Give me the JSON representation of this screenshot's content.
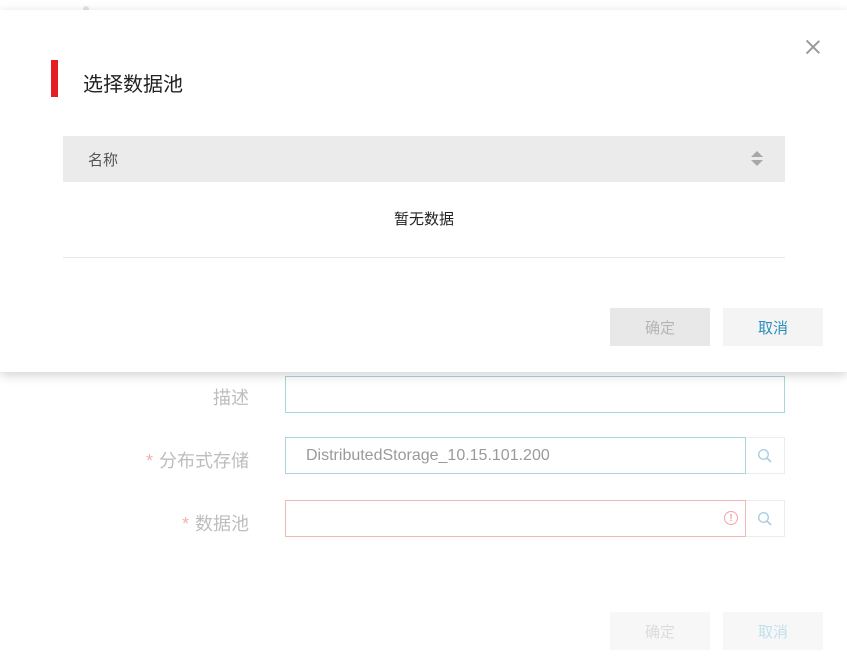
{
  "background_form": {
    "description": {
      "label": "描述",
      "value": ""
    },
    "storage": {
      "required_mark": "*",
      "label": "分布式存储",
      "value": "DistributedStorage_10.15.101.200"
    },
    "pool": {
      "required_mark": "*",
      "label": "数据池",
      "value": "",
      "error_icon": "!"
    },
    "ok_label": "确定",
    "cancel_label": "取消"
  },
  "modal": {
    "title": "选择数据池",
    "table": {
      "columns": [
        "名称"
      ],
      "empty_text": "暂无数据",
      "rows": []
    },
    "ok_label": "确定",
    "cancel_label": "取消"
  },
  "colors": {
    "accent_red": "#e51c23",
    "link_blue": "#2a8fbd",
    "error_red": "#f2a5a5"
  }
}
